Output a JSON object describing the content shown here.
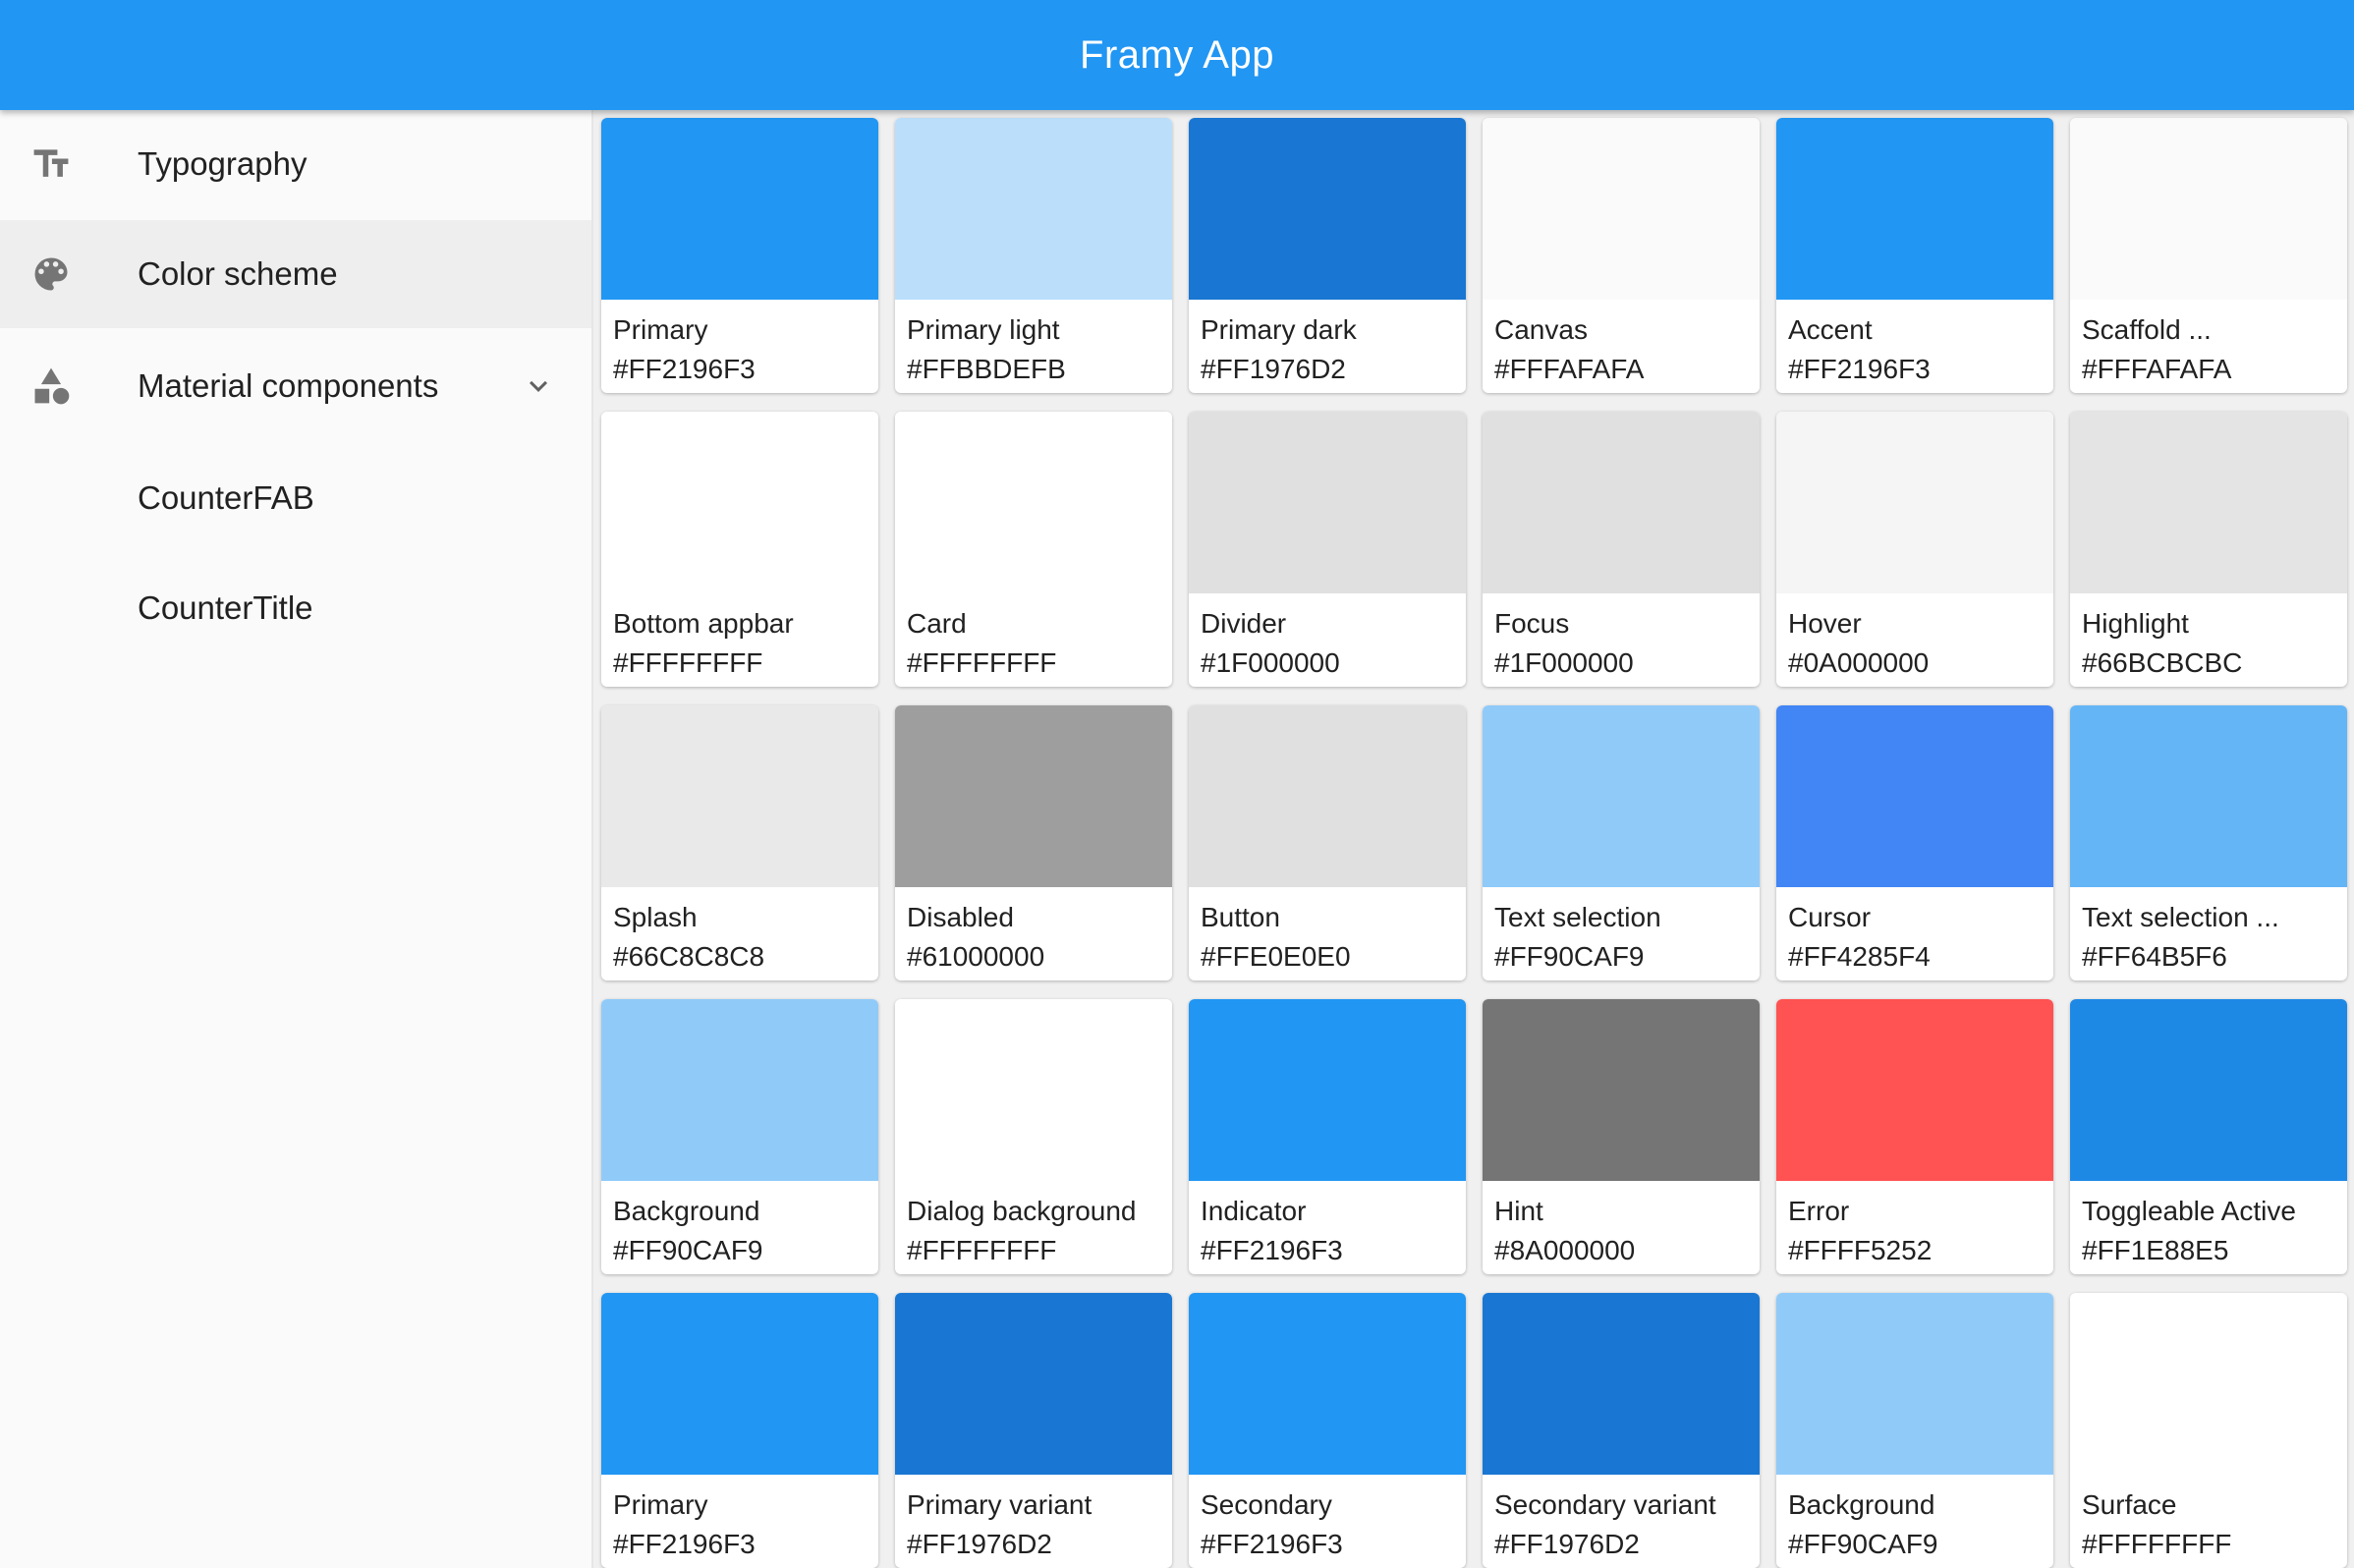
{
  "app": {
    "title": "Framy App",
    "primary_color": "#2196F3"
  },
  "sidebar": {
    "items": [
      {
        "label": "Typography",
        "icon": "text-fields-icon",
        "selected": false
      },
      {
        "label": "Color scheme",
        "icon": "palette-icon",
        "selected": true
      },
      {
        "label": "Material components",
        "icon": "category-shapes-icon",
        "expanded": true
      },
      {
        "label": "CounterFAB",
        "icon": ""
      },
      {
        "label": "CounterTitle",
        "icon": ""
      }
    ]
  },
  "colors": [
    {
      "name": "Primary",
      "hex": "#FF2196F3",
      "color": "#2196F3"
    },
    {
      "name": "Primary light",
      "hex": "#FFBBDEFB",
      "color": "#BBDEFB"
    },
    {
      "name": "Primary dark",
      "hex": "#FF1976D2",
      "color": "#1976D2"
    },
    {
      "name": "Canvas",
      "hex": "#FFFAFAFA",
      "color": "#FAFAFA"
    },
    {
      "name": "Accent",
      "hex": "#FF2196F3",
      "color": "#2196F3"
    },
    {
      "name": "Scaffold ...",
      "hex": "#FFFAFAFA",
      "color": "#FAFAFA"
    },
    {
      "name": "Bottom appbar",
      "hex": "#FFFFFFFF",
      "color": "#FFFFFF"
    },
    {
      "name": "Card",
      "hex": "#FFFFFFFF",
      "color": "#FFFFFF"
    },
    {
      "name": "Divider",
      "hex": "#1F000000",
      "color": "#E0E0E0"
    },
    {
      "name": "Focus",
      "hex": "#1F000000",
      "color": "#E0E0E0"
    },
    {
      "name": "Hover",
      "hex": "#0A000000",
      "color": "#F5F5F5"
    },
    {
      "name": "Highlight",
      "hex": "#66BCBCBC",
      "color": "#E4E4E4"
    },
    {
      "name": "Splash",
      "hex": "#66C8C8C8",
      "color": "#E9E9E9"
    },
    {
      "name": "Disabled",
      "hex": "#61000000",
      "color": "#9E9E9E"
    },
    {
      "name": "Button",
      "hex": "#FFE0E0E0",
      "color": "#E0E0E0"
    },
    {
      "name": "Text selection",
      "hex": "#FF90CAF9",
      "color": "#90CAF9"
    },
    {
      "name": "Cursor",
      "hex": "#FF4285F4",
      "color": "#4285F4"
    },
    {
      "name": "Text selection ...",
      "hex": "#FF64B5F6",
      "color": "#64B5F6"
    },
    {
      "name": "Background",
      "hex": "#FF90CAF9",
      "color": "#90CAF9"
    },
    {
      "name": "Dialog background",
      "hex": "#FFFFFFFF",
      "color": "#FFFFFF"
    },
    {
      "name": "Indicator",
      "hex": "#FF2196F3",
      "color": "#2196F3"
    },
    {
      "name": "Hint",
      "hex": "#8A000000",
      "color": "#757575"
    },
    {
      "name": "Error",
      "hex": "#FFFF5252",
      "color": "#FF5252"
    },
    {
      "name": "Toggleable Active",
      "hex": "#FF1E88E5",
      "color": "#1E88E5"
    },
    {
      "name": "Primary",
      "hex": "#FF2196F3",
      "color": "#2196F3"
    },
    {
      "name": "Primary variant",
      "hex": "#FF1976D2",
      "color": "#1976D2"
    },
    {
      "name": "Secondary",
      "hex": "#FF2196F3",
      "color": "#2196F3"
    },
    {
      "name": "Secondary variant",
      "hex": "#FF1976D2",
      "color": "#1976D2"
    },
    {
      "name": "Background",
      "hex": "#FF90CAF9",
      "color": "#90CAF9"
    },
    {
      "name": "Surface",
      "hex": "#FFFFFFFF",
      "color": "#FFFFFF"
    }
  ]
}
